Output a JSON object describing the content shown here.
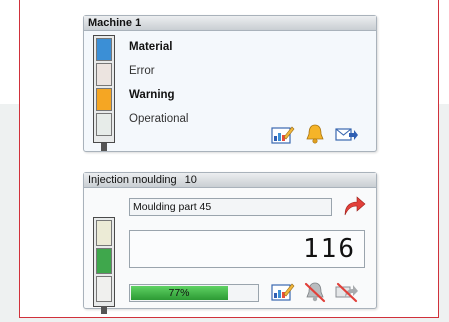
{
  "machine_panel": {
    "title": "Machine 1",
    "tower_colors": [
      "#3b8fd6",
      "#ece4e0",
      "#f5a623",
      "#e7ece9"
    ],
    "statuses": [
      {
        "label": "Material",
        "emphasis": true
      },
      {
        "label": "Error",
        "emphasis": false
      },
      {
        "label": "Warning",
        "emphasis": true
      },
      {
        "label": "Operational",
        "emphasis": false
      }
    ],
    "actions": [
      "edit-chart-icon",
      "bell-icon",
      "send-mail-icon"
    ]
  },
  "injection_panel": {
    "title": "Injection moulding",
    "title_number": "10",
    "part_name": "Moulding part 45",
    "counter": "116",
    "progress_percent": 77,
    "progress_label": "77%",
    "tower_colors": [
      "#ecebd6",
      "#3fa74c",
      "#f0f0ee"
    ],
    "actions": [
      "edit-chart-icon",
      "bell-disabled-icon",
      "forward-disabled-icon",
      "redo-arrow-icon"
    ]
  }
}
